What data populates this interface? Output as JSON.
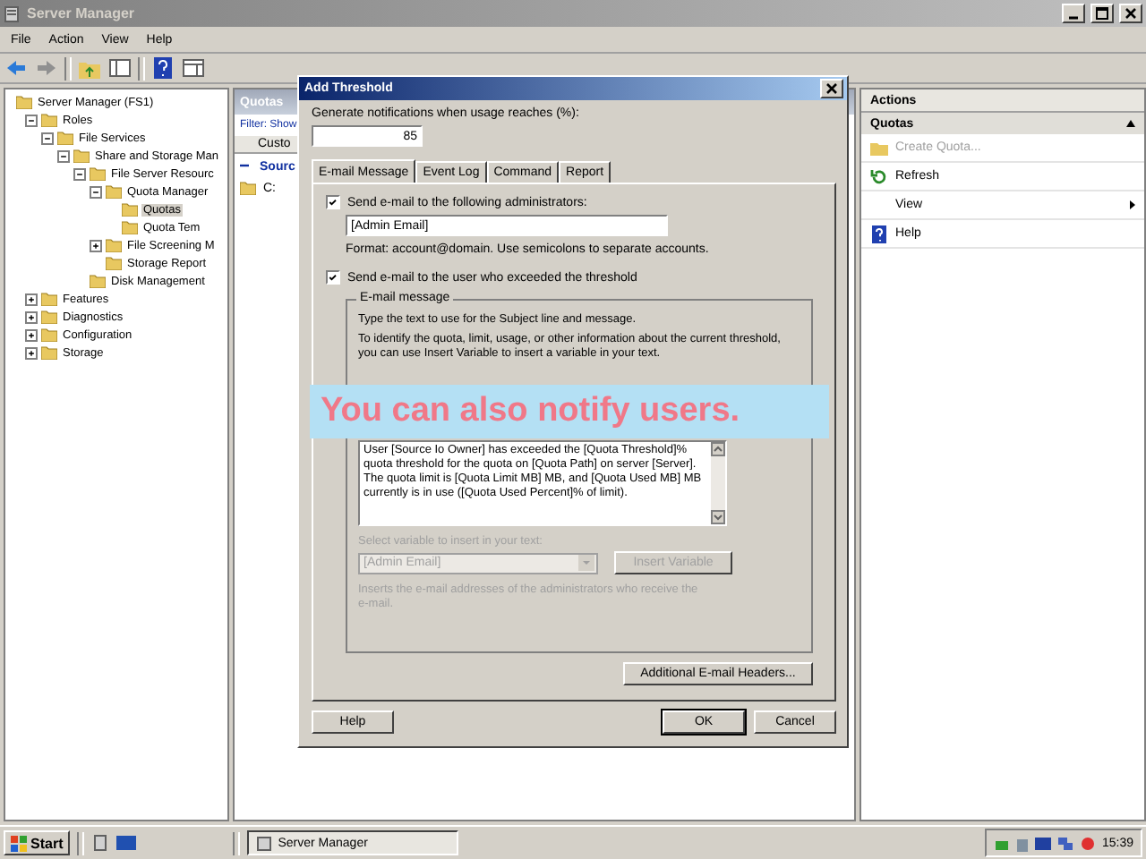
{
  "window": {
    "title": "Server Manager"
  },
  "menu": [
    {
      "label": "File"
    },
    {
      "label": "Action"
    },
    {
      "label": "View"
    },
    {
      "label": "Help"
    }
  ],
  "tree": [
    {
      "label": "Server Manager (FS1)",
      "selected": false,
      "children": [
        {
          "label": "Roles",
          "kind": "branch",
          "expanded": true,
          "selected": false,
          "children": [
            {
              "label": "File Services",
              "kind": "branch",
              "expanded": true,
              "selected": false,
              "children": [
                {
                  "label": "Share and Storage Man",
                  "kind": "branch",
                  "expanded": true,
                  "selected": false,
                  "children": [
                    {
                      "label": "File Server Resourc",
                      "kind": "branch",
                      "expanded": true,
                      "selected": false,
                      "children": [
                        {
                          "label": "Quota Manager",
                          "kind": "branch",
                          "expanded": true,
                          "selected": false,
                          "children": [
                            {
                              "label": "Quotas",
                              "kind": "leaf",
                              "selected": true
                            },
                            {
                              "label": "Quota Tem",
                              "kind": "leaf",
                              "selected": false
                            }
                          ]
                        },
                        {
                          "label": "File Screening M",
                          "kind": "branch",
                          "expanded": false,
                          "selected": false
                        },
                        {
                          "label": "Storage Report",
                          "kind": "leaf",
                          "selected": false
                        }
                      ]
                    },
                    {
                      "label": "Disk Management",
                      "kind": "leaf",
                      "selected": false
                    }
                  ]
                }
              ]
            }
          ]
        },
        {
          "label": "Features",
          "kind": "branch",
          "expanded": false,
          "selected": false
        },
        {
          "label": "Diagnostics",
          "kind": "branch",
          "expanded": false,
          "selected": false
        },
        {
          "label": "Configuration",
          "kind": "branch",
          "expanded": false,
          "selected": false
        },
        {
          "label": "Storage",
          "kind": "branch",
          "expanded": false,
          "selected": false
        }
      ]
    }
  ],
  "middle": {
    "header": "Quotas",
    "filter": "Filter: Show",
    "column": "Custo",
    "group": "Sourc",
    "rows": [
      "C:"
    ]
  },
  "actions": {
    "title": "Actions",
    "section": "Quotas",
    "items": [
      {
        "label": "Create Quota...",
        "disabled": true,
        "submenu": false
      },
      {
        "label": "Refresh",
        "disabled": false,
        "submenu": false
      },
      {
        "label": "View",
        "disabled": false,
        "submenu": true
      },
      {
        "label": "Help",
        "disabled": false,
        "submenu": false
      }
    ]
  },
  "dialog": {
    "title": "Add Threshold",
    "threshold": {
      "label": "Generate notifications when usage reaches (%):",
      "value": "85"
    },
    "tabs": [
      {
        "label": "E-mail Message",
        "selected": true
      },
      {
        "label": "Event Log",
        "selected": false
      },
      {
        "label": "Command",
        "selected": false
      },
      {
        "label": "Report",
        "selected": false
      }
    ],
    "send_admins": {
      "label": "Send e-mail to the following administrators:",
      "checked": true
    },
    "admins": {
      "value": "[Admin Email]"
    },
    "format_note": "Format: account@domain. Use semicolons to separate accounts.",
    "send_user": {
      "label": "Send e-mail to the user who exceeded the threshold",
      "checked": true
    },
    "group": {
      "title": "E-mail message",
      "intro": "Type the text to use for the Subject line and message.",
      "hint": "To identify the quota, limit, usage, or other information about the current threshold, you can use Insert Variable to insert a variable in your text."
    },
    "message_body": {
      "value": "User [Source Io Owner] has exceeded the [Quota Threshold]% quota threshold for the quota on [Quota Path] on server [Server]. The quota limit is [Quota Limit MB] MB, and [Quota Used MB] MB currently is in use ([Quota Used Percent]% of limit)."
    },
    "variables": {
      "disabled": true,
      "label": "Select variable to insert in your text:",
      "value": "[Admin Email]",
      "button": "Insert Variable",
      "description": "Inserts the e-mail addresses of the administrators who receive the e-mail."
    },
    "headers_button": "Additional E-mail Headers...",
    "buttons": [
      {
        "label": "Help",
        "default": false
      },
      {
        "label": "OK",
        "default": true
      },
      {
        "label": "Cancel",
        "default": false
      }
    ]
  },
  "callout": "You can also notify users.",
  "taskbar": {
    "start": "Start",
    "tasks": [
      {
        "label": "Server Manager",
        "selected": true
      }
    ],
    "clock": "15:39"
  }
}
